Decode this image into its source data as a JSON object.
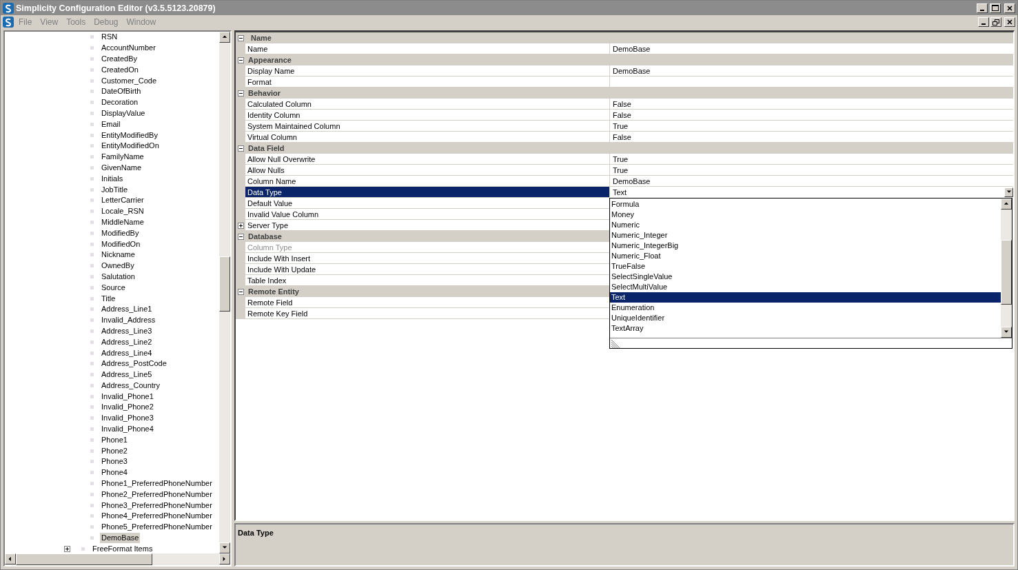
{
  "window": {
    "title": "Simplicity Configuration Editor (v3.5.5123.20879)"
  },
  "menu": {
    "items": [
      "File",
      "View",
      "Tools",
      "Debug",
      "Window"
    ]
  },
  "tree": {
    "visible_children": [
      {
        "label": "RSN",
        "selected": false
      },
      {
        "label": "AccountNumber",
        "selected": false
      },
      {
        "label": "CreatedBy",
        "selected": false
      },
      {
        "label": "CreatedOn",
        "selected": false
      },
      {
        "label": "Customer_Code",
        "selected": false
      },
      {
        "label": "DateOfBirth",
        "selected": false
      },
      {
        "label": "Decoration",
        "selected": false
      },
      {
        "label": "DisplayValue",
        "selected": false
      },
      {
        "label": "Email",
        "selected": false
      },
      {
        "label": "EntityModifiedBy",
        "selected": false
      },
      {
        "label": "EntityModifiedOn",
        "selected": false
      },
      {
        "label": "FamilyName",
        "selected": false
      },
      {
        "label": "GivenName",
        "selected": false
      },
      {
        "label": "Initials",
        "selected": false
      },
      {
        "label": "JobTitle",
        "selected": false
      },
      {
        "label": "LetterCarrier",
        "selected": false
      },
      {
        "label": "Locale_RSN",
        "selected": false
      },
      {
        "label": "MiddleName",
        "selected": false
      },
      {
        "label": "ModifiedBy",
        "selected": false
      },
      {
        "label": "ModifiedOn",
        "selected": false
      },
      {
        "label": "Nickname",
        "selected": false
      },
      {
        "label": "OwnedBy",
        "selected": false
      },
      {
        "label": "Salutation",
        "selected": false
      },
      {
        "label": "Source",
        "selected": false
      },
      {
        "label": "Title",
        "selected": false
      },
      {
        "label": "Address_Line1",
        "selected": false
      },
      {
        "label": "Invalid_Address",
        "selected": false
      },
      {
        "label": "Address_Line3",
        "selected": false
      },
      {
        "label": "Address_Line2",
        "selected": false
      },
      {
        "label": "Address_Line4",
        "selected": false
      },
      {
        "label": "Address_PostCode",
        "selected": false
      },
      {
        "label": "Address_Line5",
        "selected": false
      },
      {
        "label": "Address_Country",
        "selected": false
      },
      {
        "label": "Invalid_Phone1",
        "selected": false
      },
      {
        "label": "Invalid_Phone2",
        "selected": false
      },
      {
        "label": "Invalid_Phone3",
        "selected": false
      },
      {
        "label": "Invalid_Phone4",
        "selected": false
      },
      {
        "label": "Phone1",
        "selected": false
      },
      {
        "label": "Phone2",
        "selected": false
      },
      {
        "label": "Phone3",
        "selected": false
      },
      {
        "label": "Phone4",
        "selected": false
      },
      {
        "label": "Phone1_PreferredPhoneNumber",
        "selected": false
      },
      {
        "label": "Phone2_PreferredPhoneNumber",
        "selected": false
      },
      {
        "label": "Phone3_PreferredPhoneNumber",
        "selected": false
      },
      {
        "label": "Phone4_PreferredPhoneNumber",
        "selected": false
      },
      {
        "label": "Phone5_PreferredPhoneNumber",
        "selected": false
      },
      {
        "label": "DemoBase",
        "selected": true
      }
    ],
    "siblings": [
      {
        "label": "FreeFormat Items",
        "expanded": false
      }
    ]
  },
  "properties": {
    "categories": [
      {
        "name": "Name",
        "expanded": true,
        "items": [
          {
            "name": "Name",
            "value": "DemoBase",
            "selected": false,
            "disabled": false
          }
        ]
      },
      {
        "name": "Appearance",
        "expanded": true,
        "items": [
          {
            "name": "Display Name",
            "value": "DemoBase",
            "selected": false,
            "disabled": false
          },
          {
            "name": "Format",
            "selected": false,
            "disabled": false
          }
        ]
      },
      {
        "name": "Behavior",
        "expanded": true,
        "items": [
          {
            "name": "Calculated Column",
            "value": "False",
            "selected": false,
            "disabled": false
          },
          {
            "name": "Identity Column",
            "value": "False",
            "selected": false,
            "disabled": false
          },
          {
            "name": "System Maintained Column",
            "value": "True",
            "selected": false,
            "disabled": false
          },
          {
            "name": "Virtual Column",
            "value": "False",
            "selected": false,
            "disabled": false
          }
        ]
      },
      {
        "name": "Data Field",
        "expanded": true,
        "items": [
          {
            "name": "Allow Null Overwrite",
            "value": "True",
            "selected": false,
            "disabled": false
          },
          {
            "name": "Allow Nulls",
            "value": "True",
            "selected": false,
            "disabled": false
          },
          {
            "name": "Column Name",
            "value": "DemoBase",
            "selected": false,
            "disabled": false
          },
          {
            "name": "Data Type",
            "value": "Text",
            "selected": true,
            "disabled": false
          },
          {
            "name": "Default Value",
            "selected": false,
            "disabled": false
          },
          {
            "name": "Invalid Value Column",
            "selected": false,
            "disabled": false
          },
          {
            "name": "Server Type",
            "selected": false,
            "disabled": false,
            "expanded": false
          }
        ]
      },
      {
        "name": "Database",
        "expanded": true,
        "items": [
          {
            "name": "Column Type",
            "selected": false,
            "disabled": true
          },
          {
            "name": "Include With Insert",
            "selected": false,
            "disabled": false
          },
          {
            "name": "Include With Update",
            "selected": false,
            "disabled": false
          },
          {
            "name": "Table Index",
            "selected": false,
            "disabled": false
          }
        ]
      },
      {
        "name": "Remote Entity",
        "expanded": true,
        "items": [
          {
            "name": "Remote Field",
            "selected": false,
            "disabled": false
          },
          {
            "name": "Remote Key Field",
            "selected": false,
            "disabled": false
          }
        ]
      }
    ]
  },
  "dropdown": {
    "options": [
      {
        "label": "Formula",
        "selected": false
      },
      {
        "label": "Money",
        "selected": false
      },
      {
        "label": "Numeric",
        "selected": false
      },
      {
        "label": "Numeric_Integer",
        "selected": false
      },
      {
        "label": "Numeric_IntegerBig",
        "selected": false
      },
      {
        "label": "Numeric_Float",
        "selected": false
      },
      {
        "label": "TrueFalse",
        "selected": false
      },
      {
        "label": "SelectSingleValue",
        "selected": false
      },
      {
        "label": "SelectMultiValue",
        "selected": false
      },
      {
        "label": "Text",
        "selected": true
      },
      {
        "label": "Enumeration",
        "selected": false
      },
      {
        "label": "UniqueIdentifier",
        "selected": false
      },
      {
        "label": "TextArray",
        "selected": false
      }
    ]
  },
  "description": {
    "title": "Data Type"
  }
}
